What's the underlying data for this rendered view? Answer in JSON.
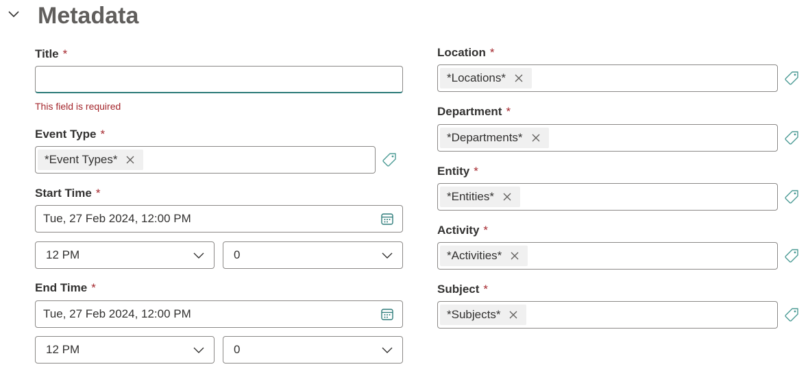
{
  "section": {
    "title": "Metadata",
    "collapse_icon": "chevron-down-icon"
  },
  "required_marker": "*",
  "left": {
    "title_field": {
      "label": "Title",
      "value": "",
      "error": "This field is required"
    },
    "event_type": {
      "label": "Event Type",
      "tag": "*Event Types*"
    },
    "start_time": {
      "label": "Start Time",
      "date": "Tue, 27 Feb 2024, 12:00 PM",
      "hour": "12 PM",
      "minute": "0"
    },
    "end_time": {
      "label": "End Time",
      "date": "Tue, 27 Feb 2024, 12:00 PM",
      "hour": "12 PM",
      "minute": "0"
    }
  },
  "right": {
    "location": {
      "label": "Location",
      "tag": "*Locations*"
    },
    "department": {
      "label": "Department",
      "tag": "*Departments*"
    },
    "entity": {
      "label": "Entity",
      "tag": "*Entities*"
    },
    "activity": {
      "label": "Activity",
      "tag": "*Activities*"
    },
    "subject": {
      "label": "Subject",
      "tag": "*Subjects*"
    }
  },
  "colors": {
    "required": "#a4262c",
    "accent": "#2b7a78",
    "tag_icon": "#4a9a94",
    "chip_bg": "#f0f0f0"
  },
  "icons": {
    "tag": "tag-icon",
    "remove": "close-icon",
    "calendar": "calendar-icon",
    "dropdown": "chevron-down-icon"
  }
}
